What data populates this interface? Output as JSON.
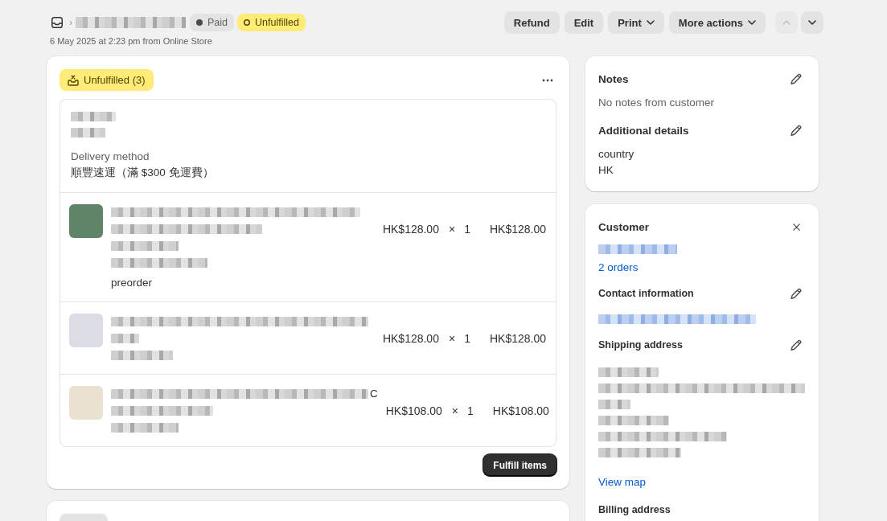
{
  "header": {
    "separator": "›",
    "badges": [
      {
        "kind": "payment",
        "label": "Paid"
      },
      {
        "kind": "fulfillment",
        "label": "Unfulfilled"
      }
    ],
    "subtitle": "6 May 2025 at 2:23 pm from Online Store",
    "actions": [
      {
        "label": "Refund",
        "dropdown": false
      },
      {
        "label": "Edit",
        "dropdown": false
      },
      {
        "label": "Print",
        "dropdown": true
      },
      {
        "label": "More actions",
        "dropdown": true
      }
    ],
    "pager": [
      {
        "kind": "up",
        "disabled": true
      },
      {
        "kind": "down",
        "disabled": false
      }
    ]
  },
  "fulfillment": {
    "badge": "Unfulfilled (3)",
    "location": [
      {
        "kind": "redacted"
      },
      {
        "kind": "redacted"
      }
    ],
    "delivery_label": "Delivery method",
    "delivery_method": "順豐速運（滿 $300 免運費）",
    "items": [
      {
        "color": "#5f8467",
        "lines": [
          {
            "kind": "redacted"
          },
          {
            "kind": "redacted"
          },
          {
            "kind": "redacted"
          },
          {
            "kind": "redacted"
          },
          {
            "kind": "text",
            "text": "preorder"
          }
        ],
        "unit_price": "HK$128.00",
        "times": "×",
        "quantity": "1",
        "total": "HK$128.00"
      },
      {
        "color": "#dcdde4",
        "lines": [
          {
            "kind": "redacted"
          },
          {
            "kind": "redacted"
          },
          {
            "kind": "redacted"
          }
        ],
        "unit_price": "HK$128.00",
        "times": "×",
        "quantity": "1",
        "total": "HK$128.00"
      },
      {
        "color": "#e9e2d2",
        "lines": [
          {
            "kind": "redacted",
            "tail": "C"
          },
          {
            "kind": "redacted"
          },
          {
            "kind": "redacted"
          }
        ],
        "unit_price": "HK$108.00",
        "times": "×",
        "quantity": "1",
        "total": "HK$108.00"
      }
    ],
    "button": "Fulfill items"
  },
  "sidebar": {
    "cards": [
      {
        "sections": [
          {
            "kind": "heading",
            "title": "Notes",
            "editable": true,
            "lines": [
              {
                "kind": "muted",
                "text": "No notes from customer"
              }
            ]
          },
          {
            "kind": "heading",
            "title": "Additional details",
            "editable": true,
            "lines": [
              {
                "kind": "text",
                "text": "country"
              },
              {
                "kind": "text",
                "text": "HK"
              }
            ]
          }
        ]
      },
      {
        "sections": [
          {
            "kind": "heading",
            "title": "Customer",
            "removable": true,
            "lines": [
              {
                "kind": "redacted-link"
              },
              {
                "kind": "link",
                "text": "2 orders"
              }
            ]
          },
          {
            "kind": "subheading",
            "title": "Contact information",
            "editable": true,
            "lines": [
              {
                "kind": "redacted-link"
              }
            ]
          },
          {
            "kind": "subheading",
            "title": "Shipping address",
            "editable": true,
            "lines": [
              {
                "kind": "redacted"
              },
              {
                "kind": "redacted"
              },
              {
                "kind": "redacted"
              },
              {
                "kind": "redacted"
              },
              {
                "kind": "redacted"
              },
              {
                "kind": "redacted"
              },
              {
                "kind": "link",
                "text": "View map"
              }
            ]
          },
          {
            "kind": "subheading",
            "title": "Billing address"
          }
        ]
      }
    ]
  }
}
